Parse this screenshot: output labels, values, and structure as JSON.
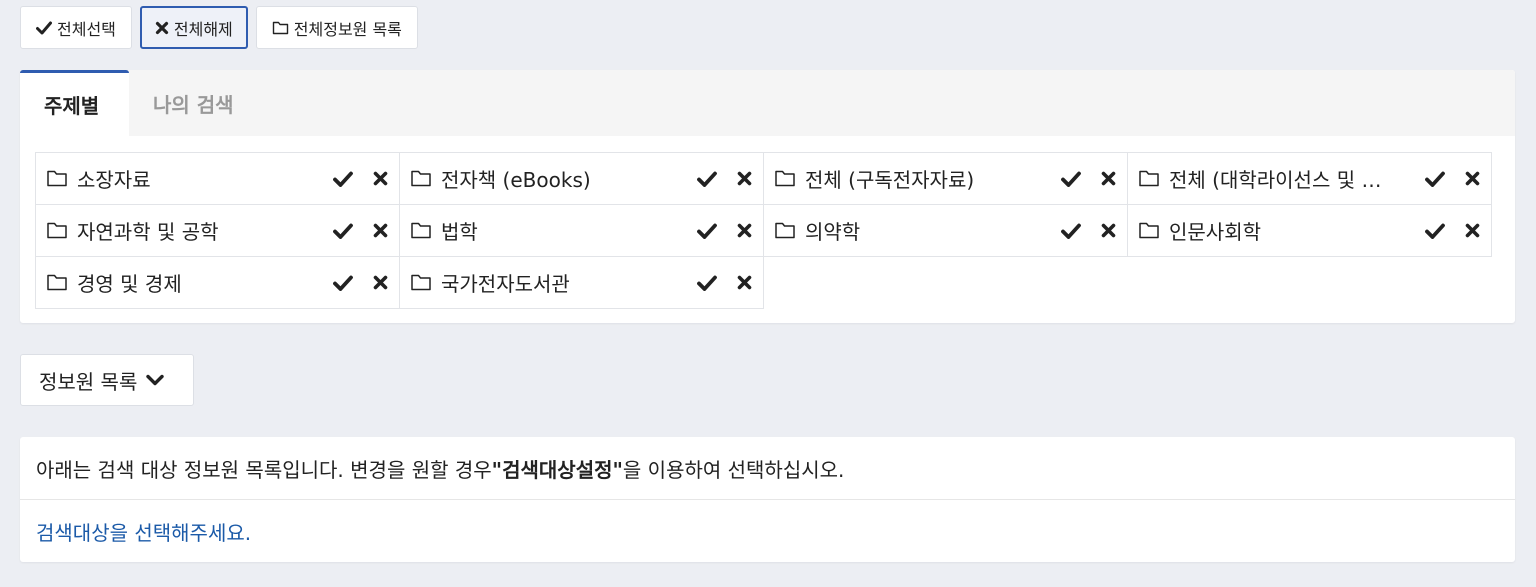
{
  "toolbar": {
    "select_all": "전체선택",
    "deselect_all": "전체해제",
    "all_sources_list": "전체정보원 목록"
  },
  "tabs": [
    {
      "label": "주제별",
      "active": true
    },
    {
      "label": "나의 검색",
      "active": false
    }
  ],
  "categories": [
    "소장자료",
    "전자책 (eBooks)",
    "전체 (구독전자자료)",
    "전체 (대학라이선스 및 …",
    "자연과학 및 공학",
    "법학",
    "의약학",
    "인문사회학",
    "경영 및 경제",
    "국가전자도서관"
  ],
  "source_list_button": "정보원 목록",
  "info": {
    "text_before": "아래는 검색 대상 정보원 목록입니다. 변경을 원할 경우 ",
    "highlight": "\"검색대상설정\"",
    "text_after": "을 이용하여 선택하십시오."
  },
  "notice": "검색대상을 선택해주세요.",
  "colors": {
    "accent": "#2f5cb0",
    "link": "#1b5aa8",
    "background": "#eceef3"
  },
  "icons": {
    "check": "check-icon",
    "close": "close-icon",
    "folder": "folder-icon",
    "chevron": "chevron-down-icon"
  }
}
